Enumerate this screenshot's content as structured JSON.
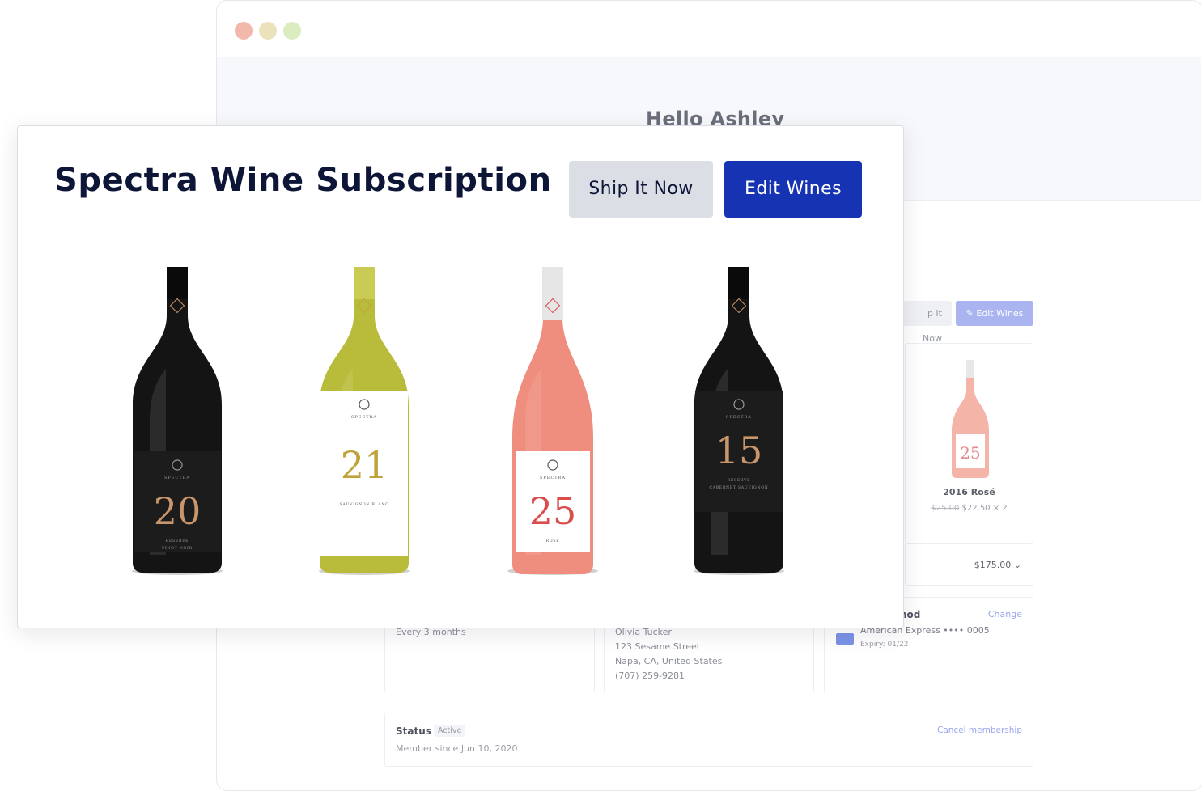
{
  "background": {
    "greeting": "Hello Ashley",
    "actions": {
      "ship_label": "p It Now",
      "edit_label": "Edit Wines"
    },
    "featured_wine": {
      "name": "2016 Rosé",
      "original_price": "$25.00",
      "price": "$22.50 × 2",
      "label_number": "25"
    },
    "total": "$175.00",
    "frequency": {
      "value": "Every 3 months"
    },
    "shipping_address": {
      "lines": [
        "Olivia Tucker",
        "123 Sesame Street",
        "Napa, CA, United States",
        "(707) 259-9281"
      ]
    },
    "payment": {
      "title": "hod",
      "change_label": "Change",
      "card": "American Express •••• 0005",
      "expiry": "Expiry: 01/22"
    },
    "status": {
      "label": "Status",
      "badge": "Active",
      "member_since": "Member since Jun 10, 2020",
      "cancel_label": "Cancel membership"
    }
  },
  "modal": {
    "title": "Spectra Wine Subscription",
    "ship_button": "Ship It Now",
    "edit_button": "Edit Wines",
    "wines": [
      {
        "number": "20",
        "label_top": "SPECTRA",
        "label_lines": [
          "RESERVE",
          "PINOT NOIR"
        ],
        "glass": "#141414",
        "label": "#1c1c1c",
        "numeral": "#c9956a",
        "text": "#9a9a9a"
      },
      {
        "number": "21",
        "label_top": "SPECTRA",
        "label_lines": [
          "SAUVIGNON BLANC"
        ],
        "glass": "#b9bb3a",
        "label": "#ffffff",
        "numeral": "#bda33a",
        "text": "#555555"
      },
      {
        "number": "25",
        "label_top": "SPECTRA",
        "label_lines": [
          "ROSÉ"
        ],
        "glass": "#ef8e7e",
        "label": "#ffffff",
        "numeral": "#d94d4d",
        "text": "#555555"
      },
      {
        "number": "15",
        "label_top": "SPECTRA",
        "label_lines": [
          "RESERVE",
          "CABERNET SAUVIGNON"
        ],
        "glass": "#141414",
        "label": "#1c1c1c",
        "numeral": "#c9956a",
        "text": "#9a9a9a"
      }
    ]
  },
  "colors": {
    "primary": "#1533b3",
    "secondary_button": "#dcdee6",
    "title": "#0e1638"
  }
}
